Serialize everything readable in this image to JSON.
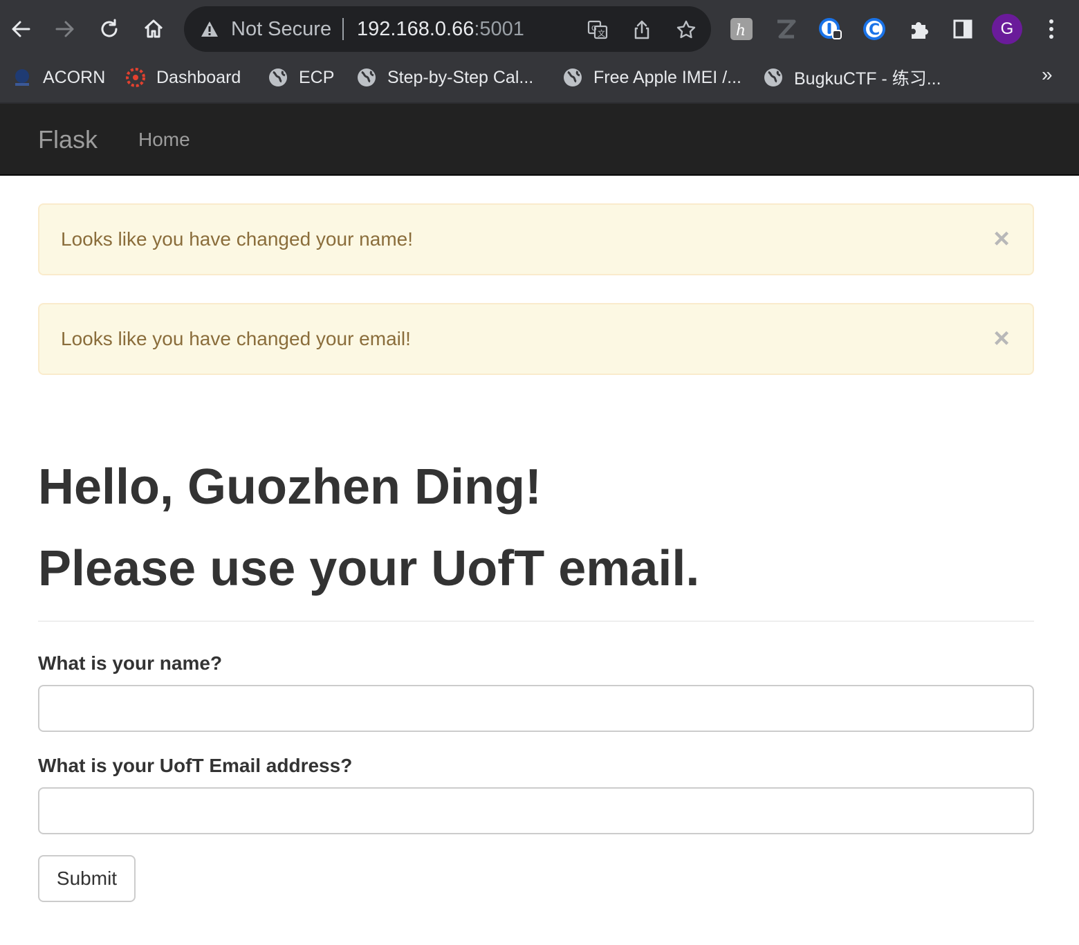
{
  "browser": {
    "omnibox": {
      "security_label": "Not Secure",
      "host": "192.168.0.66",
      "port": ":5001"
    },
    "avatar_letter": "G",
    "bookmarks": [
      {
        "label": "ACORN",
        "icon": "acorn-icon"
      },
      {
        "label": "Dashboard",
        "icon": "dashboard-icon"
      },
      {
        "label": "ECP",
        "icon": "globe-icon"
      },
      {
        "label": "Step-by-Step Cal...",
        "icon": "globe-icon"
      },
      {
        "label": "Free Apple IMEI /...",
        "icon": "globe-icon"
      },
      {
        "label": "BugkuCTF - 练习...",
        "icon": "globe-icon"
      }
    ],
    "bookmarks_overflow": "»"
  },
  "navbar": {
    "brand": "Flask",
    "home": "Home"
  },
  "alerts": [
    {
      "message": "Looks like you have changed your name!",
      "close": "×"
    },
    {
      "message": "Looks like you have changed your email!",
      "close": "×"
    }
  ],
  "header": {
    "greeting": "Hello, Guozhen Ding!",
    "instruction": "Please use your UofT email."
  },
  "form": {
    "name_label": "What is your name?",
    "name_value": "",
    "email_label": "What is your UofT Email address?",
    "email_value": "",
    "submit_label": "Submit"
  },
  "colors": {
    "navbar_bg": "#222222",
    "alert_bg": "#fcf8e3",
    "alert_text": "#8a6d3b",
    "browser_chrome": "#35363a"
  }
}
